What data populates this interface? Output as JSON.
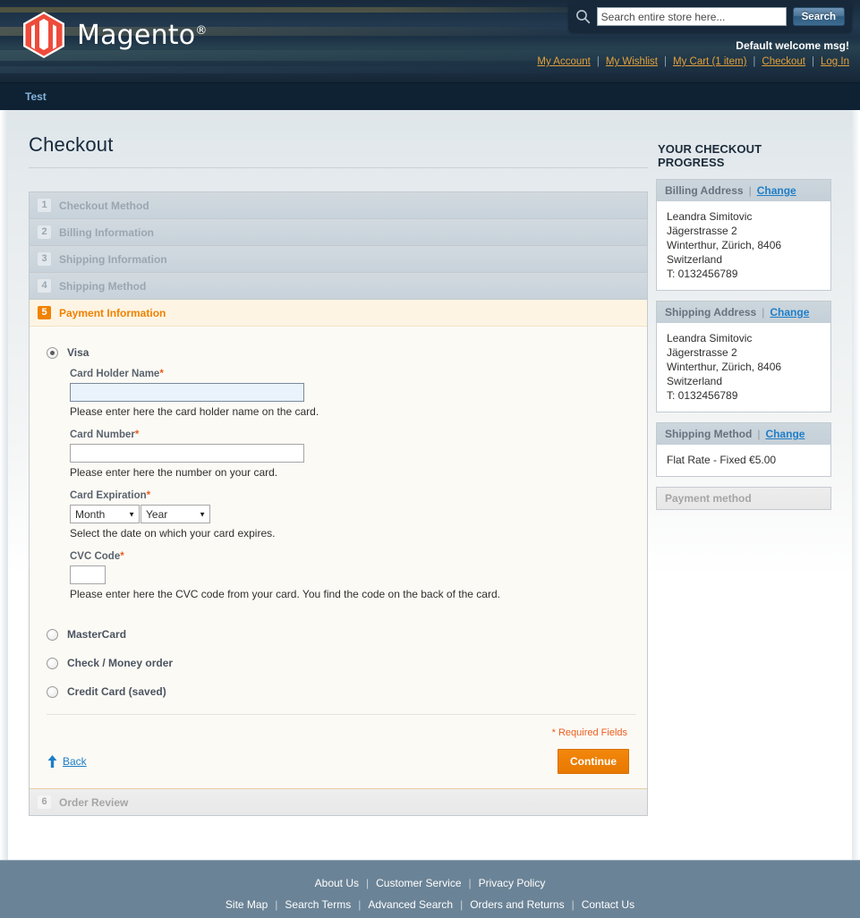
{
  "header": {
    "logo_text": "Magento",
    "logo_reg": "®",
    "search": {
      "icon": "search-icon",
      "placeholder": "Search entire store here...",
      "value": "",
      "button_label": "Search"
    },
    "welcome": "Default welcome msg!",
    "links": [
      {
        "label": "My Account"
      },
      {
        "label": "My Wishlist"
      },
      {
        "label": "My Cart (1 item)"
      },
      {
        "label": "Checkout"
      },
      {
        "label": "Log In"
      }
    ],
    "separator": "|"
  },
  "nav": {
    "items": [
      {
        "label": "Test"
      }
    ]
  },
  "main": {
    "page_title": "Checkout",
    "steps": [
      {
        "num": "1",
        "label": "Checkout Method",
        "state": "inactive"
      },
      {
        "num": "2",
        "label": "Billing Information",
        "state": "inactive"
      },
      {
        "num": "3",
        "label": "Shipping Information",
        "state": "inactive"
      },
      {
        "num": "4",
        "label": "Shipping Method",
        "state": "inactive"
      },
      {
        "num": "5",
        "label": "Payment Information",
        "state": "active"
      },
      {
        "num": "6",
        "label": "Order Review",
        "state": "gray"
      }
    ],
    "payment": {
      "methods": [
        {
          "label": "Visa",
          "selected": true
        },
        {
          "label": "MasterCard",
          "selected": false
        },
        {
          "label": "Check / Money order",
          "selected": false
        },
        {
          "label": "Credit Card (saved)",
          "selected": false
        }
      ],
      "card_holder": {
        "label": "Card Holder Name",
        "required": "*",
        "value": "",
        "hint": "Please enter here the card holder name on the card."
      },
      "card_number": {
        "label": "Card Number",
        "required": "*",
        "value": "",
        "hint": "Please enter here the number on your card."
      },
      "card_expiration": {
        "label": "Card Expiration",
        "required": "*",
        "month_value": "Month",
        "year_value": "Year",
        "month_options": [
          "Month"
        ],
        "year_options": [
          "Year"
        ],
        "hint": "Select the date on which your card expires."
      },
      "cvc": {
        "label": "CVC Code",
        "required": "*",
        "value": "",
        "hint": "Please enter here the CVC code from your card. You find the code on the back of the card."
      },
      "required_note": "* Required Fields",
      "back_label": "Back",
      "continue_label": "Continue"
    }
  },
  "sidebar": {
    "title": "YOUR CHECKOUT PROGRESS",
    "change_label": "Change",
    "separator": "|",
    "blocks": [
      {
        "title": "Billing Address",
        "has_change": true,
        "lines": [
          "Leandra Simitovic",
          "Jägerstrasse 2",
          "Winterthur, Zürich, 8406",
          "Switzerland",
          "T: 0132456789"
        ]
      },
      {
        "title": "Shipping Address",
        "has_change": true,
        "lines": [
          "Leandra Simitovic",
          "Jägerstrasse 2",
          "Winterthur, Zürich, 8406",
          "Switzerland",
          "T: 0132456789"
        ]
      },
      {
        "title": "Shipping Method",
        "has_change": true,
        "lines": [
          "Flat Rate - Fixed €5.00"
        ]
      },
      {
        "title": "Payment method",
        "has_change": false,
        "lines": []
      }
    ]
  },
  "footer": {
    "row1": [
      {
        "label": "About Us"
      },
      {
        "label": "Customer Service"
      },
      {
        "label": "Privacy Policy"
      }
    ],
    "row2": [
      {
        "label": "Site Map"
      },
      {
        "label": "Search Terms"
      },
      {
        "label": "Advanced Search"
      },
      {
        "label": "Orders and Returns"
      },
      {
        "label": "Contact Us"
      }
    ],
    "separator": "|"
  },
  "colors": {
    "accent_orange": "#f08200",
    "link_blue": "#1e7ec8",
    "top_link_gold": "#e3a13b",
    "header_navy": "#1b3042",
    "footer_slate": "#6b8396",
    "required_red": "#eb5d1e"
  }
}
